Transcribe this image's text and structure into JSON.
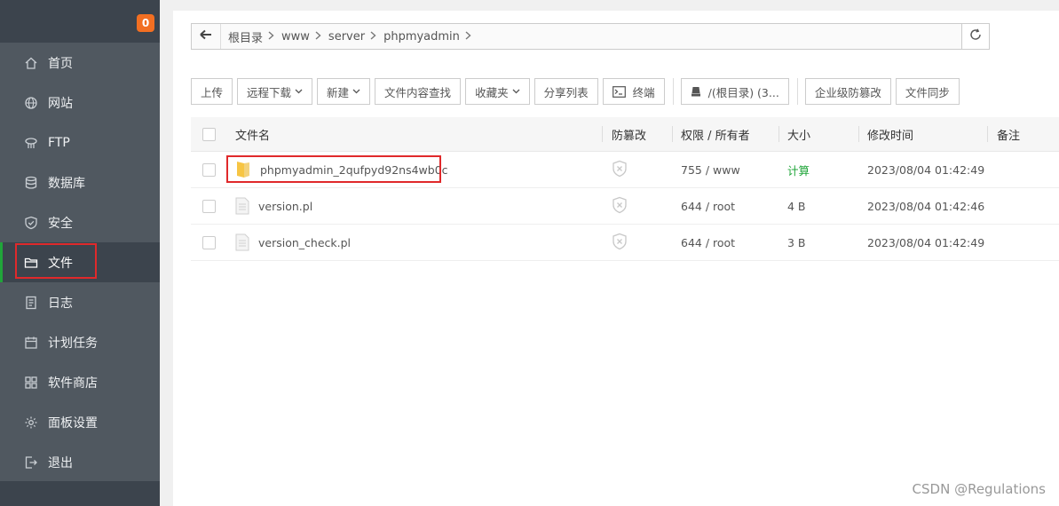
{
  "sidebar": {
    "badge": "0",
    "items": [
      {
        "label": "首页",
        "icon": "home-icon"
      },
      {
        "label": "网站",
        "icon": "globe-icon"
      },
      {
        "label": "FTP",
        "icon": "ftp-icon"
      },
      {
        "label": "数据库",
        "icon": "database-icon"
      },
      {
        "label": "安全",
        "icon": "shield-icon"
      },
      {
        "label": "文件",
        "icon": "folder-icon",
        "active": true
      },
      {
        "label": "日志",
        "icon": "log-icon"
      },
      {
        "label": "计划任务",
        "icon": "calendar-icon"
      },
      {
        "label": "软件商店",
        "icon": "grid-icon"
      },
      {
        "label": "面板设置",
        "icon": "gear-icon"
      },
      {
        "label": "退出",
        "icon": "exit-icon"
      }
    ]
  },
  "path": {
    "crumbs": [
      "根目录",
      "www",
      "server",
      "phpmyadmin"
    ]
  },
  "toolbar": {
    "upload": "上传",
    "remote_download": "远程下载",
    "new": "新建",
    "search_content": "文件内容查找",
    "favorites": "收藏夹",
    "share_list": "分享列表",
    "terminal": "终端",
    "disk": "/(根目录) (3...",
    "tamper_proof": "企业级防篡改",
    "sync": "文件同步"
  },
  "table": {
    "headers": {
      "name": "文件名",
      "protect": "防篡改",
      "perm": "权限 / 所有者",
      "size": "大小",
      "mtime": "修改时间",
      "note": "备注"
    },
    "rows": [
      {
        "name": "phpmyadmin_2qufpyd92ns4wb0c",
        "type": "folder",
        "perm": "755 / www",
        "size": "计算",
        "mtime": "2023/08/04 01:42:49"
      },
      {
        "name": "version.pl",
        "type": "file",
        "perm": "644 / root",
        "size": "4 B",
        "mtime": "2023/08/04 01:42:46"
      },
      {
        "name": "version_check.pl",
        "type": "file",
        "perm": "644 / root",
        "size": "3 B",
        "mtime": "2023/08/04 01:42:49"
      }
    ]
  },
  "watermark": "CSDN @Regulations",
  "colors": {
    "sidebar_bg": "#3c444d",
    "menu_bg": "#505860",
    "accent_green": "#20a53a",
    "badge_orange": "#f26f22",
    "highlight_red": "#e0292b"
  }
}
